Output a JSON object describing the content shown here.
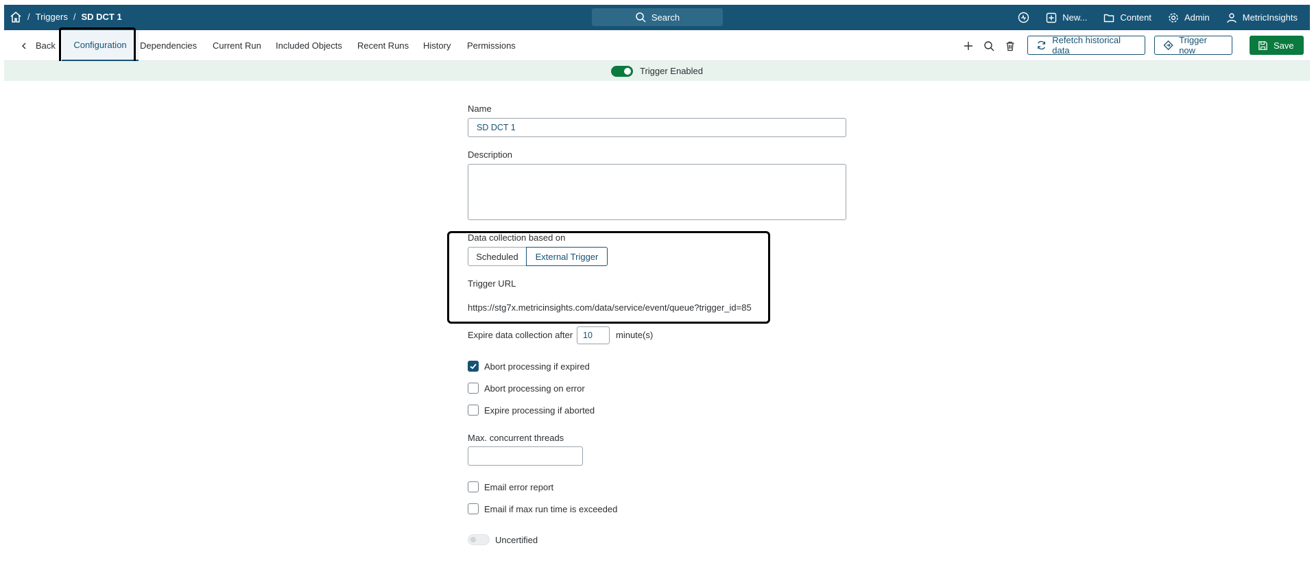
{
  "topbar": {
    "breadcrumb": [
      "Triggers",
      "SD DCT 1"
    ],
    "search_label": "Search",
    "new_label": "New...",
    "content_label": "Content",
    "admin_label": "Admin",
    "user_label": "MetricInsights"
  },
  "tabs": {
    "back_label": "Back",
    "items": [
      "Configuration",
      "Dependencies",
      "Current Run",
      "Included Objects",
      "Recent Runs",
      "History",
      "Permissions"
    ],
    "active": "Configuration"
  },
  "toolbar": {
    "refetch_label": "Refetch historical data",
    "trigger_now_label": "Trigger now",
    "save_label": "Save"
  },
  "status": {
    "enabled_label": "Trigger Enabled",
    "enabled": true
  },
  "form": {
    "name_label": "Name",
    "name_value": "SD DCT 1",
    "description_label": "Description",
    "description_value": "",
    "collection_label": "Data collection based on",
    "collection_options": [
      "Scheduled",
      "External Trigger"
    ],
    "collection_selected": "External Trigger",
    "trigger_url_label": "Trigger URL",
    "trigger_url_value": "https://stg7x.metricinsights.com/data/service/event/queue?trigger_id=85",
    "expire_label": "Expire data collection after",
    "expire_value": "10",
    "expire_unit": "minute(s)",
    "abort_expired_label": "Abort processing if expired",
    "abort_expired_checked": true,
    "abort_error_label": "Abort processing on error",
    "abort_error_checked": false,
    "expire_aborted_label": "Expire processing if aborted",
    "expire_aborted_checked": false,
    "threads_label": "Max. concurrent threads",
    "threads_value": "",
    "email_error_label": "Email error report",
    "email_error_checked": false,
    "email_max_label": "Email if max run time is exceeded",
    "email_max_checked": false,
    "certified_label": "Uncertified",
    "certified": false
  },
  "colors": {
    "brand": "#175375",
    "save": "#0b7a3f",
    "enabled_strip": "#e8f3ee"
  }
}
